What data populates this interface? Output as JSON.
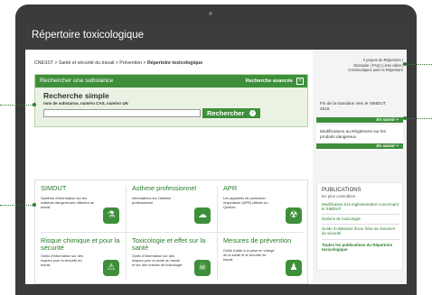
{
  "page": {
    "title": "Répertoire toxicologique"
  },
  "breadcrumb": {
    "items": [
      "CNESST",
      "Santé et sécurité du travail",
      "Prévention"
    ],
    "separator": ">",
    "current": "Répertoire toxicologique"
  },
  "search": {
    "header": "Rechercher une substance",
    "advanced_label": "Recherche avancée",
    "advanced_icon": "advanced-search-icon",
    "heading": "Recherche simple",
    "hint": "nom de substance, numéro CAS, numéro UN",
    "input_value": "",
    "placeholder": "",
    "button_label": "Rechercher"
  },
  "tiles": [
    {
      "title": "SIMDUT",
      "desc": "Système d'information sur les matières dangereuses utilisées au travail",
      "icon": "flask-icon",
      "glyph": "⚗"
    },
    {
      "title": "Asthme professionnel",
      "desc": "Informations sur l'asthme professionnel",
      "icon": "lungs-icon",
      "glyph": "☁"
    },
    {
      "title": "APR",
      "desc": "Les appareils de protection respiratoire (APR) utilisés au Québec",
      "icon": "respirator-icon",
      "glyph": "☢"
    },
    {
      "title": "Risque chimique et pour la sécurité",
      "desc": "Outils d'information sur des risques pour la sécurité au travail",
      "icon": "beaker-icon",
      "glyph": "⚠"
    },
    {
      "title": "Toxicologie et effet sur la santé",
      "desc": "Outils d'information sur des risques pour la santé au travail et sur des notions de toxicologie",
      "icon": "skull-icon",
      "glyph": "☠"
    },
    {
      "title": "Mesures de prévention",
      "desc": "Outils d'aide à la prise en charge de la santé et la sécurité du travail",
      "icon": "worker-icon",
      "glyph": "♟"
    }
  ],
  "sidebar": {
    "links": [
      "À propos du Répertoire |",
      "Glossaire | FAQ | Liens utiles |",
      "Communiquez avec le Répertoire"
    ],
    "boxes": [
      {
        "text": "Fin de la transition vers le SIMDUT 2015",
        "more": "En savoir +"
      },
      {
        "text": "Modifications au Règlement sur les produits dangereux",
        "more": "En savoir +"
      }
    ],
    "publications": {
      "heading": "PUBLICATIONS",
      "subheading": "les plus consultées",
      "links": [
        "Modification à la réglementation concernant le SIMDUT",
        "Notions de toxicologie",
        "Guide d'utilisation d'une fiche de données de sécurité",
        "Toutes les publications du Répertoire toxicologique"
      ]
    }
  },
  "colors": {
    "accent": "#3e8f3a",
    "header_bg": "#3d3d3d",
    "device_frame": "#3a3a3a",
    "link_green": "#2a7a2a"
  }
}
